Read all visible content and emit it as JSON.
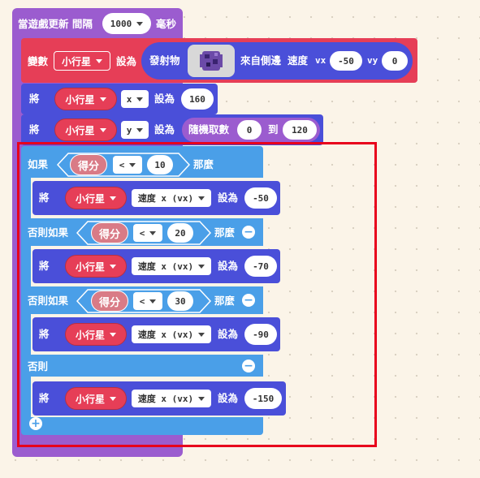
{
  "event": {
    "label": "當遊戲更新 間隔",
    "interval": "1000",
    "unit": "毫秒"
  },
  "set_sprite": {
    "prefix": "變數",
    "var": "小行星",
    "assign": "設為",
    "sprite_label": "發射物",
    "from_side": "來自側邊",
    "speed": "速度",
    "vx_label": "vx",
    "vx": "-50",
    "vy_label": "vy",
    "vy": "0"
  },
  "set_x": {
    "prefix": "將",
    "var": "小行星",
    "prop": "x",
    "assign": "設為",
    "value": "160"
  },
  "set_y": {
    "prefix": "將",
    "var": "小行星",
    "prop": "y",
    "assign": "設為",
    "rand_label": "隨機取數",
    "from": "0",
    "to_label": "到",
    "to": "120"
  },
  "if_block": {
    "if_label": "如果",
    "then_label": "那麼",
    "elseif_label": "否則如果",
    "else_label": "否則",
    "branches": [
      {
        "score": "得分",
        "op": "<",
        "threshold": "10"
      },
      {
        "score": "得分",
        "op": "<",
        "threshold": "20"
      },
      {
        "score": "得分",
        "op": "<",
        "threshold": "30"
      }
    ],
    "actions": [
      {
        "prefix": "將",
        "var": "小行星",
        "prop": "速度 x (vx)",
        "assign": "設為",
        "value": "-50"
      },
      {
        "prefix": "將",
        "var": "小行星",
        "prop": "速度 x (vx)",
        "assign": "設為",
        "value": "-70"
      },
      {
        "prefix": "將",
        "var": "小行星",
        "prop": "速度 x (vx)",
        "assign": "設為",
        "value": "-90"
      },
      {
        "prefix": "將",
        "var": "小行星",
        "prop": "速度 x (vx)",
        "assign": "設為",
        "value": "-150"
      }
    ]
  },
  "colors": {
    "event": "#9b5ccf",
    "sprite": "#e63e57",
    "logic": "#4a9fe8",
    "math": "#9b5ccf",
    "highlight": "#e8001c"
  }
}
